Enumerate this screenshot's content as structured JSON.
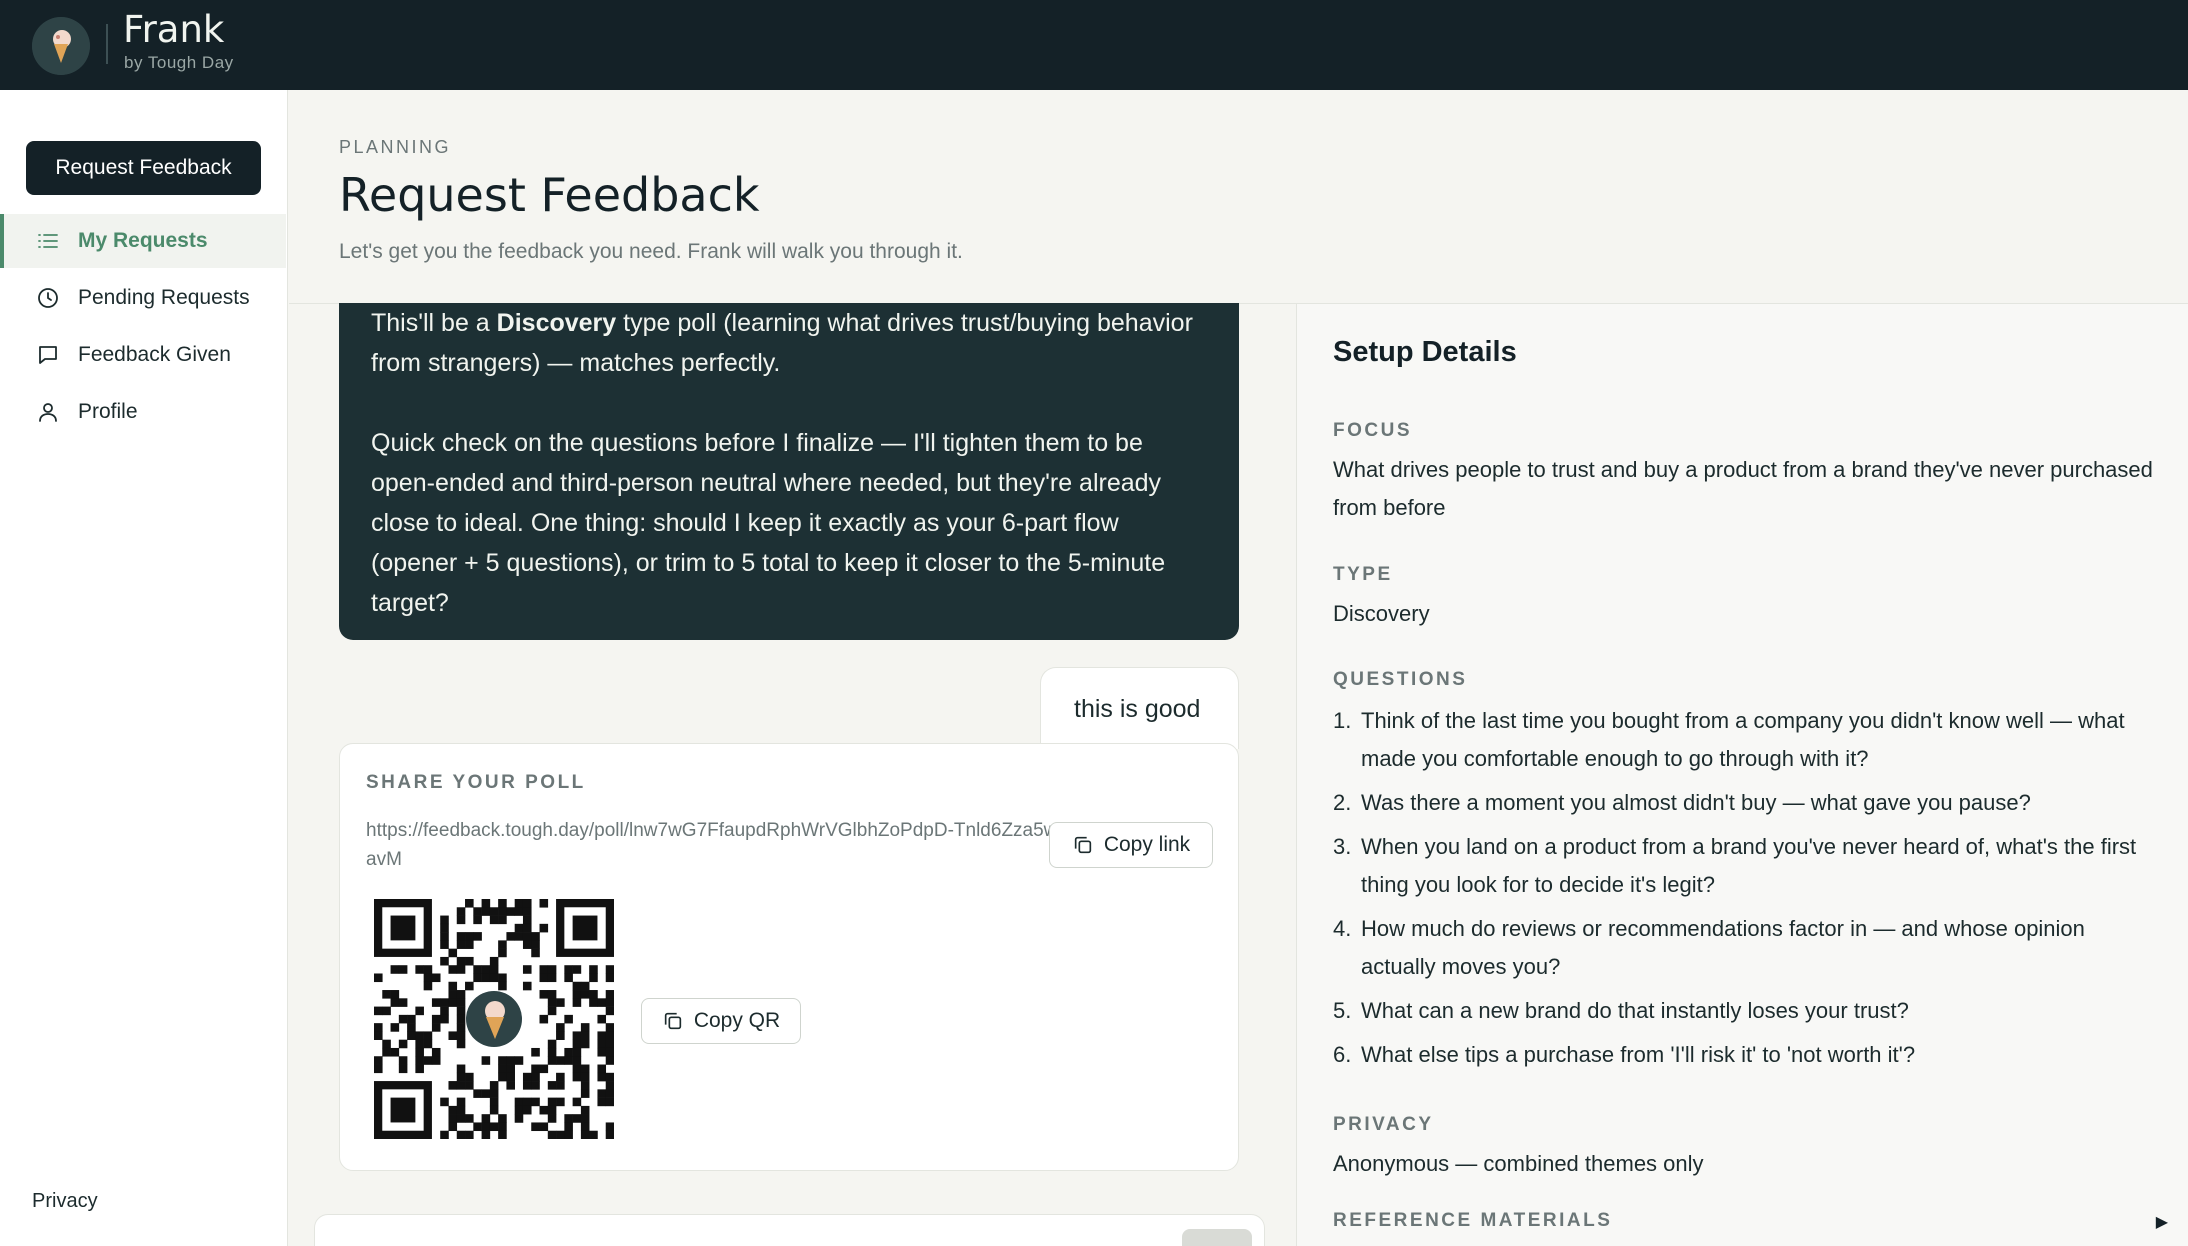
{
  "app": {
    "name": "Frank",
    "byline": "by Tough Day"
  },
  "sidebar": {
    "primary_button": "Request Feedback",
    "items": [
      {
        "label": "My Requests",
        "icon": "list-icon",
        "active": true
      },
      {
        "label": "Pending Requests",
        "icon": "clock-icon"
      },
      {
        "label": "Feedback Given",
        "icon": "message-icon"
      },
      {
        "label": "Profile",
        "icon": "user-icon"
      }
    ],
    "privacy": "Privacy"
  },
  "header": {
    "eyebrow": "PLANNING",
    "title": "Request Feedback",
    "subtitle": "Let's get you the feedback you need. Frank will walk you through it."
  },
  "chat": {
    "assistant": {
      "p1_before": "This'll be a ",
      "p1_bold": "Discovery",
      "p1_after": " type poll (learning what drives trust/buying behavior from strangers) — matches perfectly.",
      "p2": "Quick check on the questions before I finalize — I'll tighten them to be open-ended and third-person neutral where needed, but they're already close to ideal. One thing: should I keep it exactly as your 6-part flow (opener + 5 questions), or trim to 5 total to keep it closer to the 5-minute target?"
    },
    "user": "this is good"
  },
  "share": {
    "title": "SHARE YOUR POLL",
    "url": "https://feedback.tough.day/poll/lnw7wG7FfaupdRphWrVGlbhZoPdpD-Tnld6Zza5wavM",
    "copy_link": "Copy link",
    "copy_qr": "Copy QR"
  },
  "details": {
    "title": "Setup Details",
    "focus_label": "FOCUS",
    "focus": "What drives people to trust and buy a product from a brand they've never purchased from before",
    "type_label": "TYPE",
    "type": "Discovery",
    "questions_label": "QUESTIONS",
    "questions": [
      "Think of the last time you bought from a company you didn't know well — what made you comfortable enough to go through with it?",
      "Was there a moment you almost didn't buy — what gave you pause?",
      "When you land on a product from a brand you've never heard of, what's the first thing you look for to decide it's legit?",
      "How much do reviews or recommendations factor in — and whose opinion actually moves you?",
      "What can a new brand do that instantly loses your trust?",
      "What else tips a purchase from 'I'll risk it' to 'not worth it'?"
    ],
    "privacy_label": "PRIVACY",
    "privacy": "Anonymous — combined themes only",
    "reference_label": "REFERENCE MATERIALS"
  },
  "colors": {
    "topbar": "#142127",
    "accent_green": "#4b8a6b",
    "bubble_dark": "#1d3034",
    "background": "#f5f5f1"
  }
}
